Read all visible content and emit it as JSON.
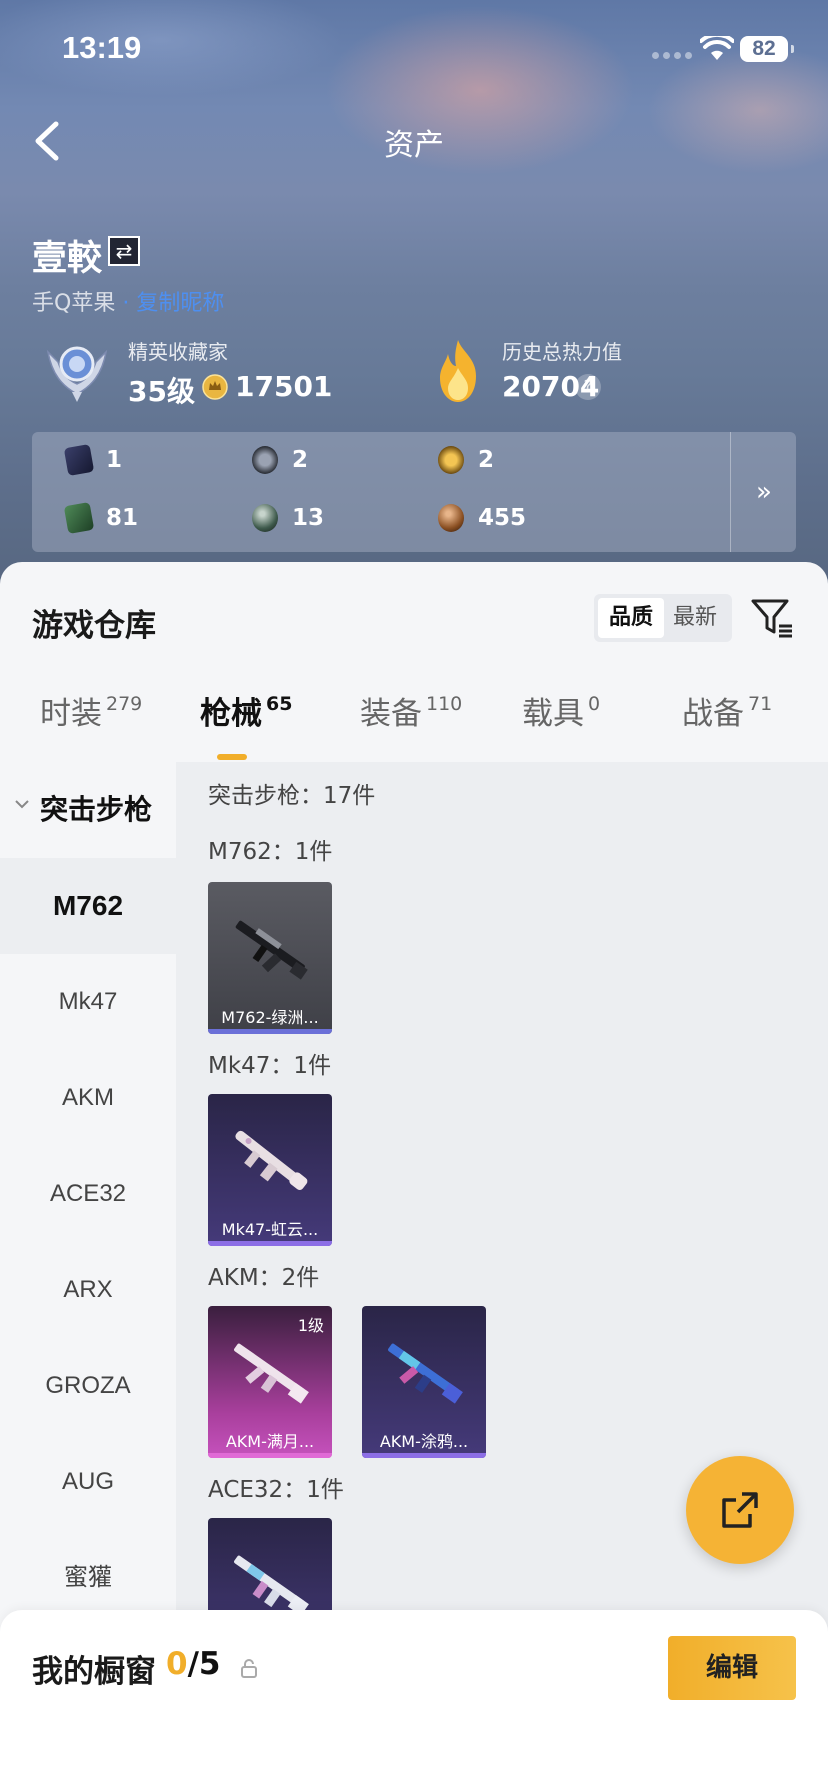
{
  "status_bar": {
    "time": "13:19",
    "battery": "82"
  },
  "nav": {
    "title": "资产"
  },
  "profile": {
    "username": "壹較",
    "platform": "手Q苹果",
    "platform_link": "· 复制昵称"
  },
  "collector": {
    "title": "精英收藏家",
    "level": "35级",
    "points": "17501"
  },
  "heat": {
    "title": "历史总热力值",
    "value": "20704",
    "help": "?"
  },
  "item_counts": [
    {
      "icon": "card-icon",
      "value": "1"
    },
    {
      "icon": "gear-badge-icon",
      "value": "2"
    },
    {
      "icon": "gold-badge-icon",
      "value": "2"
    },
    {
      "icon": "green-card-icon",
      "value": "81"
    },
    {
      "icon": "orb-icon",
      "value": "13"
    },
    {
      "icon": "bronze-coin-icon",
      "value": "455"
    }
  ],
  "panel_more": "»",
  "warehouse": {
    "title": "游戏仓库",
    "sort_options": [
      "品质",
      "最新"
    ],
    "tabs": [
      {
        "label": "时装",
        "count": "279"
      },
      {
        "label": "枪械",
        "count": "65"
      },
      {
        "label": "装备",
        "count": "110"
      },
      {
        "label": "载具",
        "count": "0"
      },
      {
        "label": "战备",
        "count": "71"
      }
    ],
    "category": "突击步枪",
    "sidebar_items": [
      "M762",
      "Mk47",
      "AKM",
      "ACE32",
      "ARX",
      "GROZA",
      "AUG",
      "蜜獾"
    ],
    "summary": "突击步枪：17件",
    "groups": [
      {
        "label": "M762：1件",
        "items": [
          {
            "name": "M762-绿洲..."
          }
        ]
      },
      {
        "label": "Mk47：1件",
        "items": [
          {
            "name": "Mk47-虹云..."
          }
        ]
      },
      {
        "label": "AKM：2件",
        "items": [
          {
            "name": "AKM-满月...",
            "level": "1级"
          },
          {
            "name": "AKM-涂鸦..."
          }
        ]
      },
      {
        "label": "ACE32：1件",
        "items": [
          {
            "name": ""
          }
        ]
      }
    ]
  },
  "showcase": {
    "title": "我的橱窗",
    "current": "0",
    "total": "/5",
    "edit": "编辑"
  },
  "colors": {
    "accent": "#f1ae2a",
    "link": "#4e8ff0",
    "rarity_purple": "#8c6ee6",
    "rarity_pink": "#e06ad6"
  }
}
